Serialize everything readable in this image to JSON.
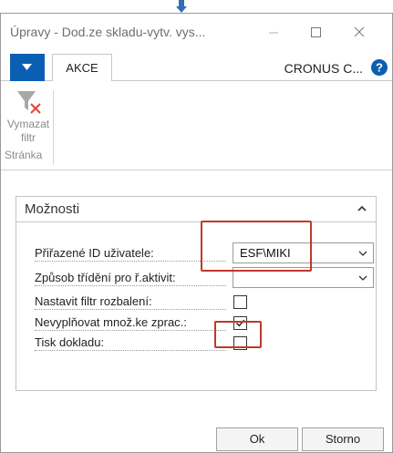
{
  "window": {
    "title": "Úpravy - Dod.ze skladu-vytv. vys..."
  },
  "tabs": {
    "akce": "AKCE"
  },
  "company": "CRONUS C...",
  "ribbon": {
    "button_label_line1": "Vymazat",
    "button_label_line2": "filtr",
    "group_label": "Stránka"
  },
  "panel": {
    "title": "Možnosti",
    "fields": [
      {
        "label": "Přiřazené ID uživatele:",
        "type": "dropdown",
        "value": "ESF\\MIKI"
      },
      {
        "label": "Způsob třídění pro ř.aktivit:",
        "type": "dropdown",
        "value": ""
      },
      {
        "label": "Nastavit filtr rozbalení:",
        "type": "checkbox",
        "checked": false
      },
      {
        "label": "Nevyplňovat množ.ke zprac.:",
        "type": "checkbox",
        "checked": true
      },
      {
        "label": "Tisk dokladu:",
        "type": "checkbox",
        "checked": false
      }
    ]
  },
  "buttons": {
    "ok": "Ok",
    "storno": "Storno"
  },
  "colors": {
    "accent": "#0a5fb3",
    "highlight": "#c0392b"
  }
}
